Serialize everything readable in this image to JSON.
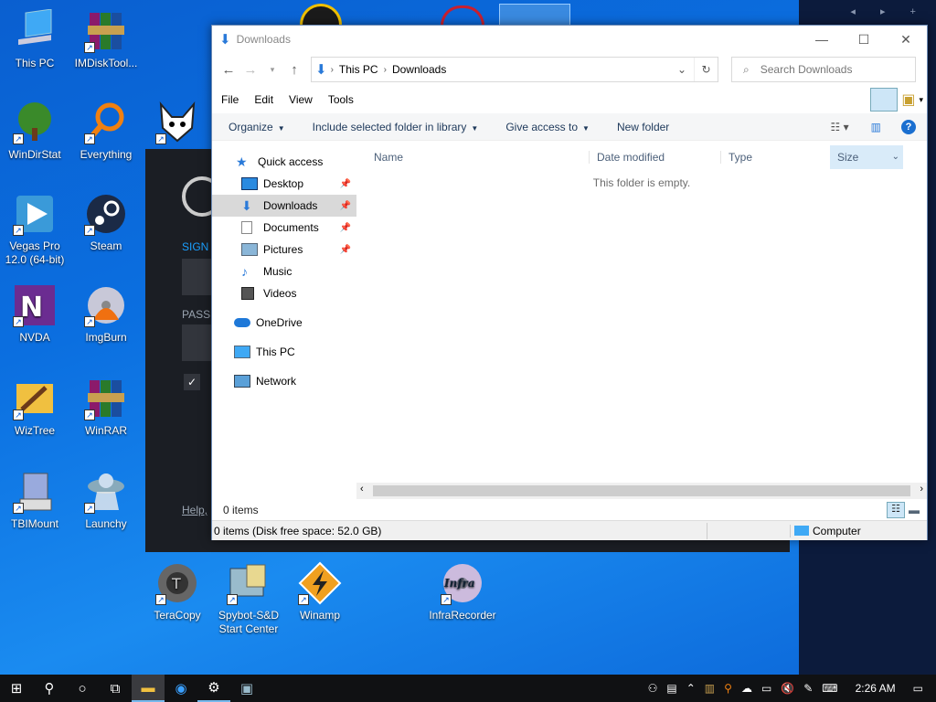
{
  "desktop": {
    "icons": [
      {
        "label": "This PC",
        "icon": "computer-icon"
      },
      {
        "label": "IMDiskTool...",
        "icon": "winrar-books-icon"
      },
      {
        "label": "WinDirStat",
        "icon": "tree-icon"
      },
      {
        "label": "Everything",
        "icon": "magnifier-icon"
      },
      {
        "label": "Vegas Pro 12.0 (64-bit)",
        "icon": "play-icon"
      },
      {
        "label": "Steam",
        "icon": "steam-icon"
      },
      {
        "label": "NVDA",
        "icon": "nvda-icon"
      },
      {
        "label": "ImgBurn",
        "icon": "disc-flame-icon"
      },
      {
        "label": "WizTree",
        "icon": "wand-icon"
      },
      {
        "label": "WinRAR",
        "icon": "winrar-books-icon"
      },
      {
        "label": "TBIMount",
        "icon": "mount-icon"
      },
      {
        "label": "Launchy",
        "icon": "ufo-icon"
      },
      {
        "label": "TeraCopy",
        "icon": "teracopy-icon"
      },
      {
        "label": "Spybot-S&D Start Center",
        "icon": "spybot-icon"
      },
      {
        "label": "Winamp",
        "icon": "winamp-icon"
      },
      {
        "label": "InfraRecorder",
        "icon": "infrarecorder-icon"
      }
    ]
  },
  "steam": {
    "sign": "SIGN",
    "pass": "PASS",
    "help": "Help,"
  },
  "explorer": {
    "title": "Downloads",
    "address": {
      "root": "This PC",
      "current": "Downloads"
    },
    "search_placeholder": "Search Downloads",
    "menu": [
      "File",
      "Edit",
      "View",
      "Tools"
    ],
    "toolbar": {
      "organize": "Organize",
      "include": "Include selected folder in library",
      "give": "Give access to",
      "newfolder": "New folder"
    },
    "nav": [
      {
        "label": "Quick access",
        "icon": "star-icon"
      },
      {
        "label": "Desktop",
        "icon": "desktop-folder-icon"
      },
      {
        "label": "Downloads",
        "icon": "download-arrow-icon"
      },
      {
        "label": "Documents",
        "icon": "document-icon"
      },
      {
        "label": "Pictures",
        "icon": "pictures-icon"
      },
      {
        "label": "Music",
        "icon": "music-note-icon"
      },
      {
        "label": "Videos",
        "icon": "film-icon"
      },
      {
        "label": "OneDrive",
        "icon": "cloud-icon"
      },
      {
        "label": "This PC",
        "icon": "computer-icon"
      },
      {
        "label": "Network",
        "icon": "network-icon"
      }
    ],
    "columns": [
      "Name",
      "Date modified",
      "Type",
      "Size"
    ],
    "empty_text": "This folder is empty.",
    "items_count": "0 items",
    "status_left": "0 items (Disk free space: 52.0 GB)",
    "status_right": "Computer"
  },
  "taskbar": {
    "time": "2:26 AM"
  }
}
